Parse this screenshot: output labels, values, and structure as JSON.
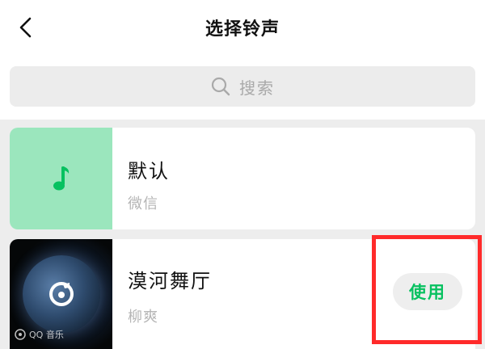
{
  "header": {
    "title": "选择铃声",
    "back_icon": "chevron-left-icon"
  },
  "search": {
    "placeholder": "搜索",
    "icon": "search-icon"
  },
  "ringtones": [
    {
      "title": "默认",
      "subtitle": "微信",
      "cover_icon": "music-note-icon",
      "cover_color": "#9be6bd",
      "icon_color": "#07c160"
    },
    {
      "title": "漠河舞厅",
      "subtitle": "柳爽",
      "cover_badge": "QQ 音乐",
      "cover_icon": "qq-music-logo-icon",
      "action_label": "使用",
      "action_color": "#07c160"
    }
  ],
  "annotation": {
    "color": "#ff2a2a",
    "target": "use-button"
  }
}
